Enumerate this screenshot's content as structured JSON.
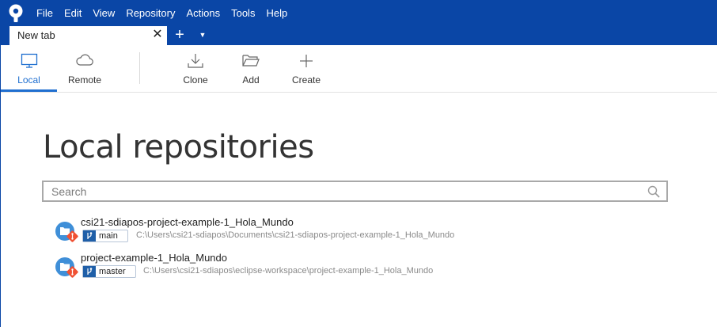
{
  "menu": [
    "File",
    "Edit",
    "View",
    "Repository",
    "Actions",
    "Tools",
    "Help"
  ],
  "tab": {
    "title": "New tab"
  },
  "toolbar": {
    "local_label": "Local",
    "remote_label": "Remote",
    "clone_label": "Clone",
    "add_label": "Add",
    "create_label": "Create"
  },
  "page": {
    "title": "Local repositories",
    "search_placeholder": "Search"
  },
  "repositories": [
    {
      "name": "csi21-sdiapos-project-example-1_Hola_Mundo",
      "branch": "main",
      "path": "C:\\Users\\csi21-sdiapos\\Documents\\csi21-sdiapos-project-example-1_Hola_Mundo"
    },
    {
      "name": "project-example-1_Hola_Mundo",
      "branch": "master",
      "path": "C:\\Users\\csi21-sdiapos\\eclipse-workspace\\project-example-1_Hola_Mundo"
    }
  ],
  "colors": {
    "titlebar": "#0a46a6",
    "accent": "#1f6fd0",
    "git_badge": "#f05133",
    "folder_circle": "#3f8fd8"
  }
}
